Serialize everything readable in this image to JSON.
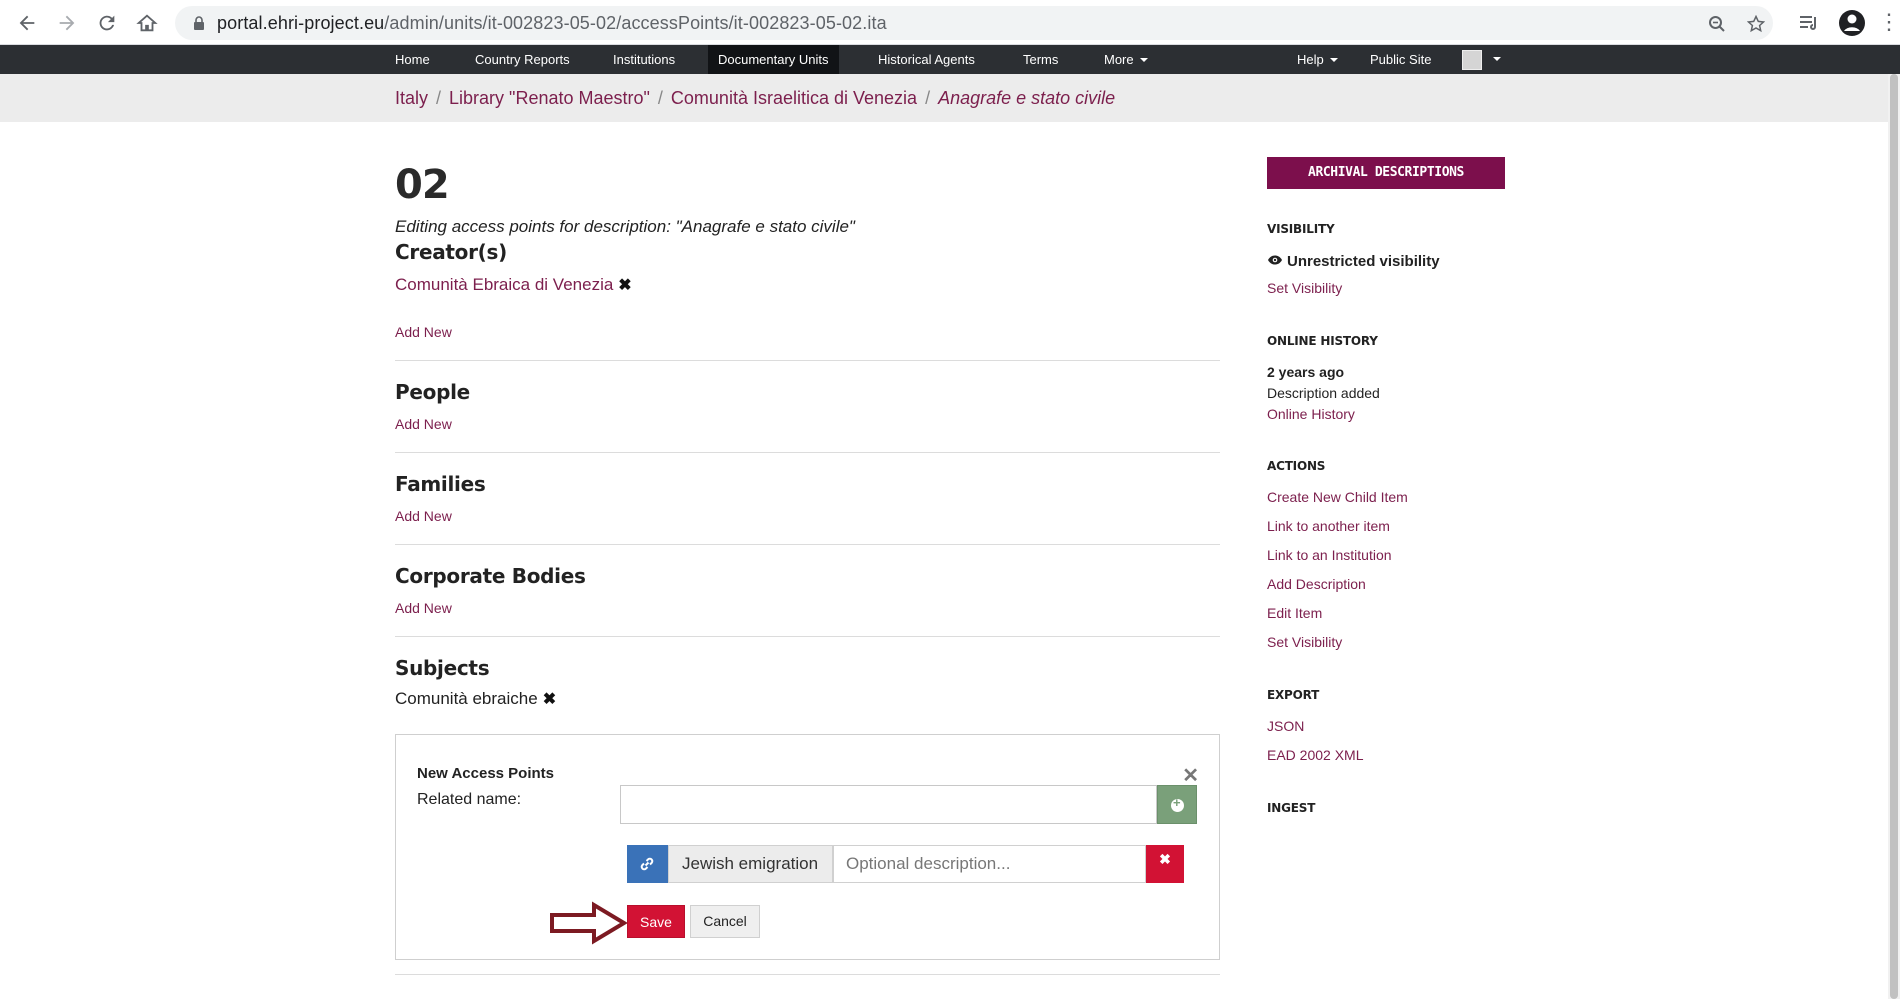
{
  "browser": {
    "url_host": "portal.ehri-project.eu",
    "url_path": "/admin/units/it-002823-05-02/accessPoints/it-002823-05-02.ita"
  },
  "topnav": {
    "items": [
      {
        "label": "Home"
      },
      {
        "label": "Country Reports"
      },
      {
        "label": "Institutions"
      },
      {
        "label": "Documentary Units",
        "active": true
      },
      {
        "label": "Historical Agents"
      },
      {
        "label": "Terms"
      },
      {
        "label": "More"
      }
    ],
    "help_label": "Help",
    "public_site_label": "Public Site"
  },
  "breadcrumb": {
    "items": [
      "Italy",
      "Library \"Renato Maestro\"",
      "Comunità Israelitica di Venezia"
    ],
    "current": "Anagrafe e stato civile"
  },
  "main": {
    "title": "02",
    "subtitle": "Editing access points for description: \"Anagrafe e stato civile\"",
    "creators": {
      "heading": "Creator(s)",
      "entry": "Comunità Ebraica di Venezia",
      "add_new": "Add New"
    },
    "people": {
      "heading": "People",
      "add_new": "Add New"
    },
    "families": {
      "heading": "Families",
      "add_new": "Add New"
    },
    "corporate": {
      "heading": "Corporate Bodies",
      "add_new": "Add New"
    },
    "subjects": {
      "heading": "Subjects",
      "entry": "Comunità ebraiche"
    },
    "new_access_points": {
      "title": "New Access Points",
      "related_name_label": "Related name:",
      "related_name_value": "",
      "selected_term": "Jewish emigration",
      "description_placeholder": "Optional description...",
      "save_label": "Save",
      "cancel_label": "Cancel"
    }
  },
  "sidebar": {
    "button_label": "ARCHIVAL DESCRIPTIONS",
    "visibility": {
      "heading": "VISIBILITY",
      "status": "Unrestricted visibility",
      "link": "Set Visibility"
    },
    "history": {
      "heading": "ONLINE HISTORY",
      "time": "2 years ago",
      "event": "Description added",
      "link": "Online History"
    },
    "actions": {
      "heading": "ACTIONS",
      "items": [
        "Create New Child Item",
        "Link to another item",
        "Link to an Institution",
        "Add Description",
        "Edit Item",
        "Set Visibility"
      ]
    },
    "export": {
      "heading": "EXPORT",
      "items": [
        "JSON",
        "EAD 2002 XML"
      ]
    },
    "ingest": {
      "heading": "INGEST"
    }
  },
  "colors": {
    "brand": "#7c0f4c",
    "link": "#7c1f4d",
    "danger": "#d21234",
    "nav_bg": "#2c2f33"
  }
}
